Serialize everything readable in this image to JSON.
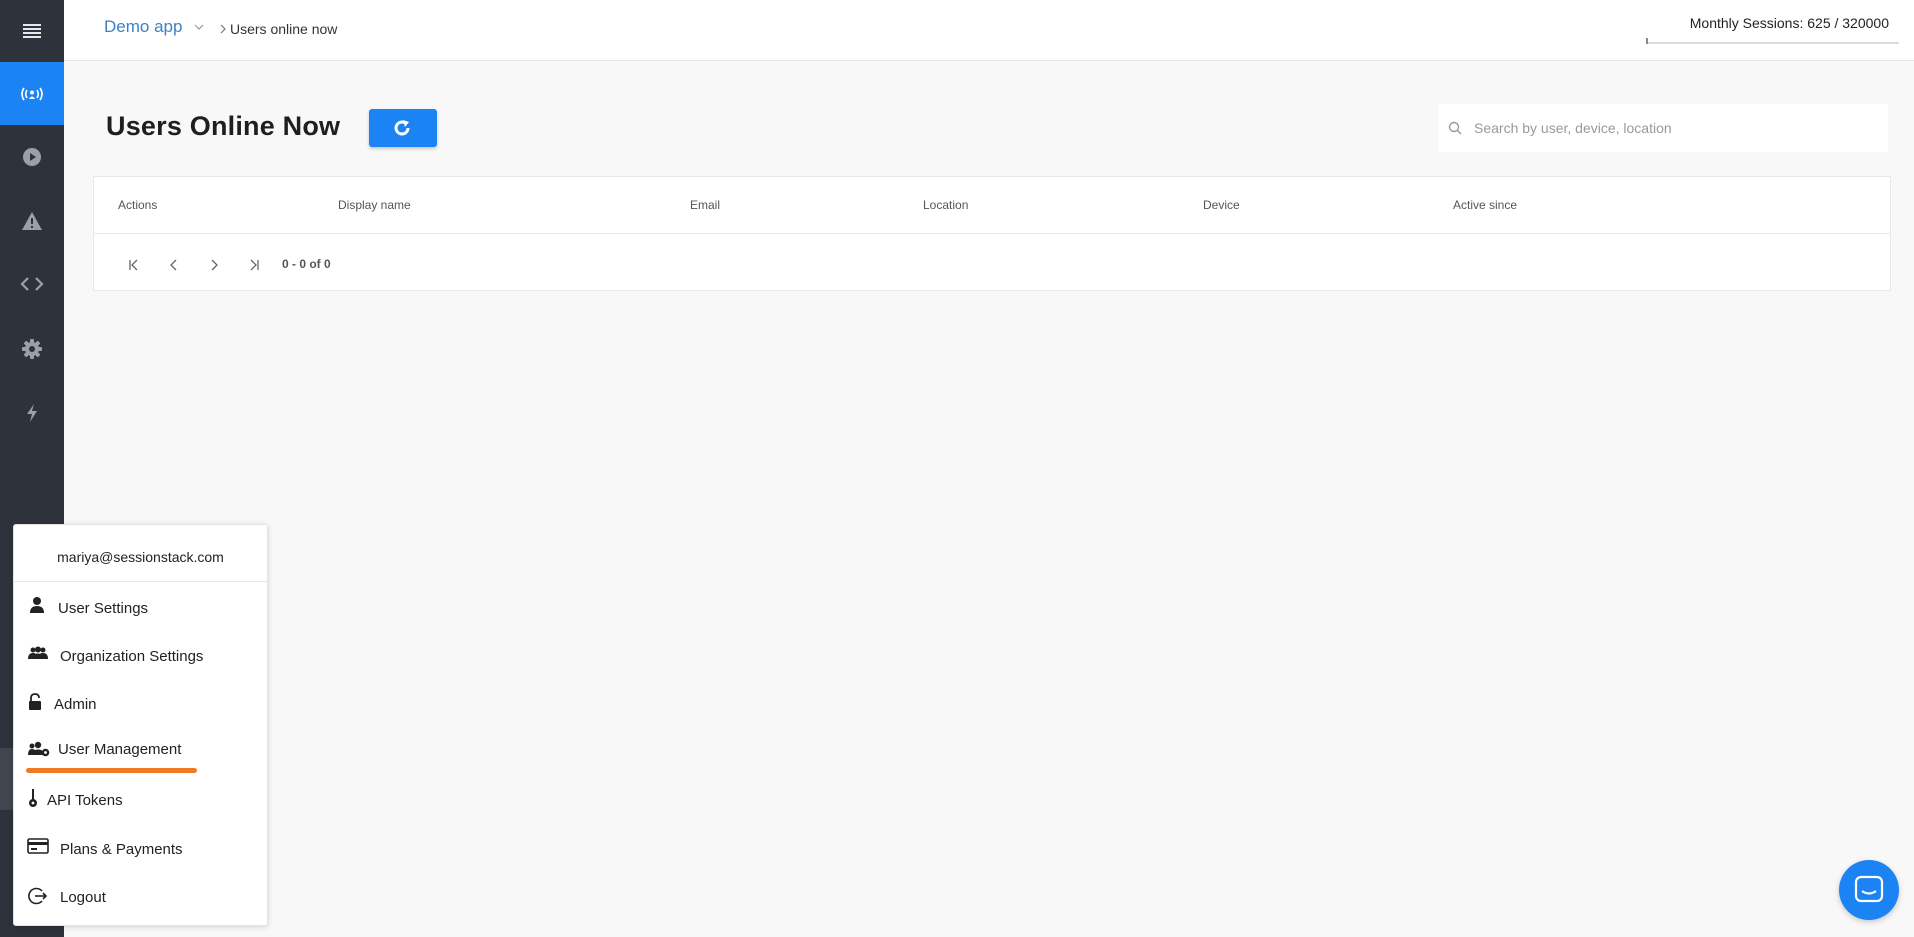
{
  "header": {
    "app_name": "Demo app",
    "breadcrumb_current": "Users online now",
    "monthly_sessions": "Monthly Sessions: 625 / 320000"
  },
  "sidebar": {
    "items": [
      {
        "icon": "menu-icon"
      },
      {
        "icon": "live-broadcast-icon",
        "active": true
      },
      {
        "icon": "play-icon"
      },
      {
        "icon": "warning-icon"
      },
      {
        "icon": "code-icon"
      },
      {
        "icon": "gear-icon"
      },
      {
        "icon": "lightning-icon"
      }
    ]
  },
  "page": {
    "title": "Users Online Now",
    "search_placeholder": "Search by user, device, location"
  },
  "table": {
    "columns": [
      "Actions",
      "Display name",
      "Email",
      "Location",
      "Device",
      "Active since"
    ],
    "rows": [],
    "pagination_text": "0 - 0 of 0"
  },
  "user_menu": {
    "email": "mariya@sessionstack.com",
    "items": [
      {
        "label": "User Settings",
        "icon": "user-icon"
      },
      {
        "label": "Organization Settings",
        "icon": "group-icon"
      },
      {
        "label": "Admin",
        "icon": "lock-icon"
      },
      {
        "label": "User Management",
        "icon": "user-management-icon",
        "highlighted": true
      },
      {
        "label": "API Tokens",
        "icon": "key-icon"
      },
      {
        "label": "Plans & Payments",
        "icon": "credit-card-icon"
      },
      {
        "label": "Logout",
        "icon": "logout-icon"
      }
    ]
  },
  "colors": {
    "accent": "#1c83f5",
    "sidebar_bg": "#2d323b",
    "highlight": "#f07a21",
    "link": "#3b82c4"
  }
}
